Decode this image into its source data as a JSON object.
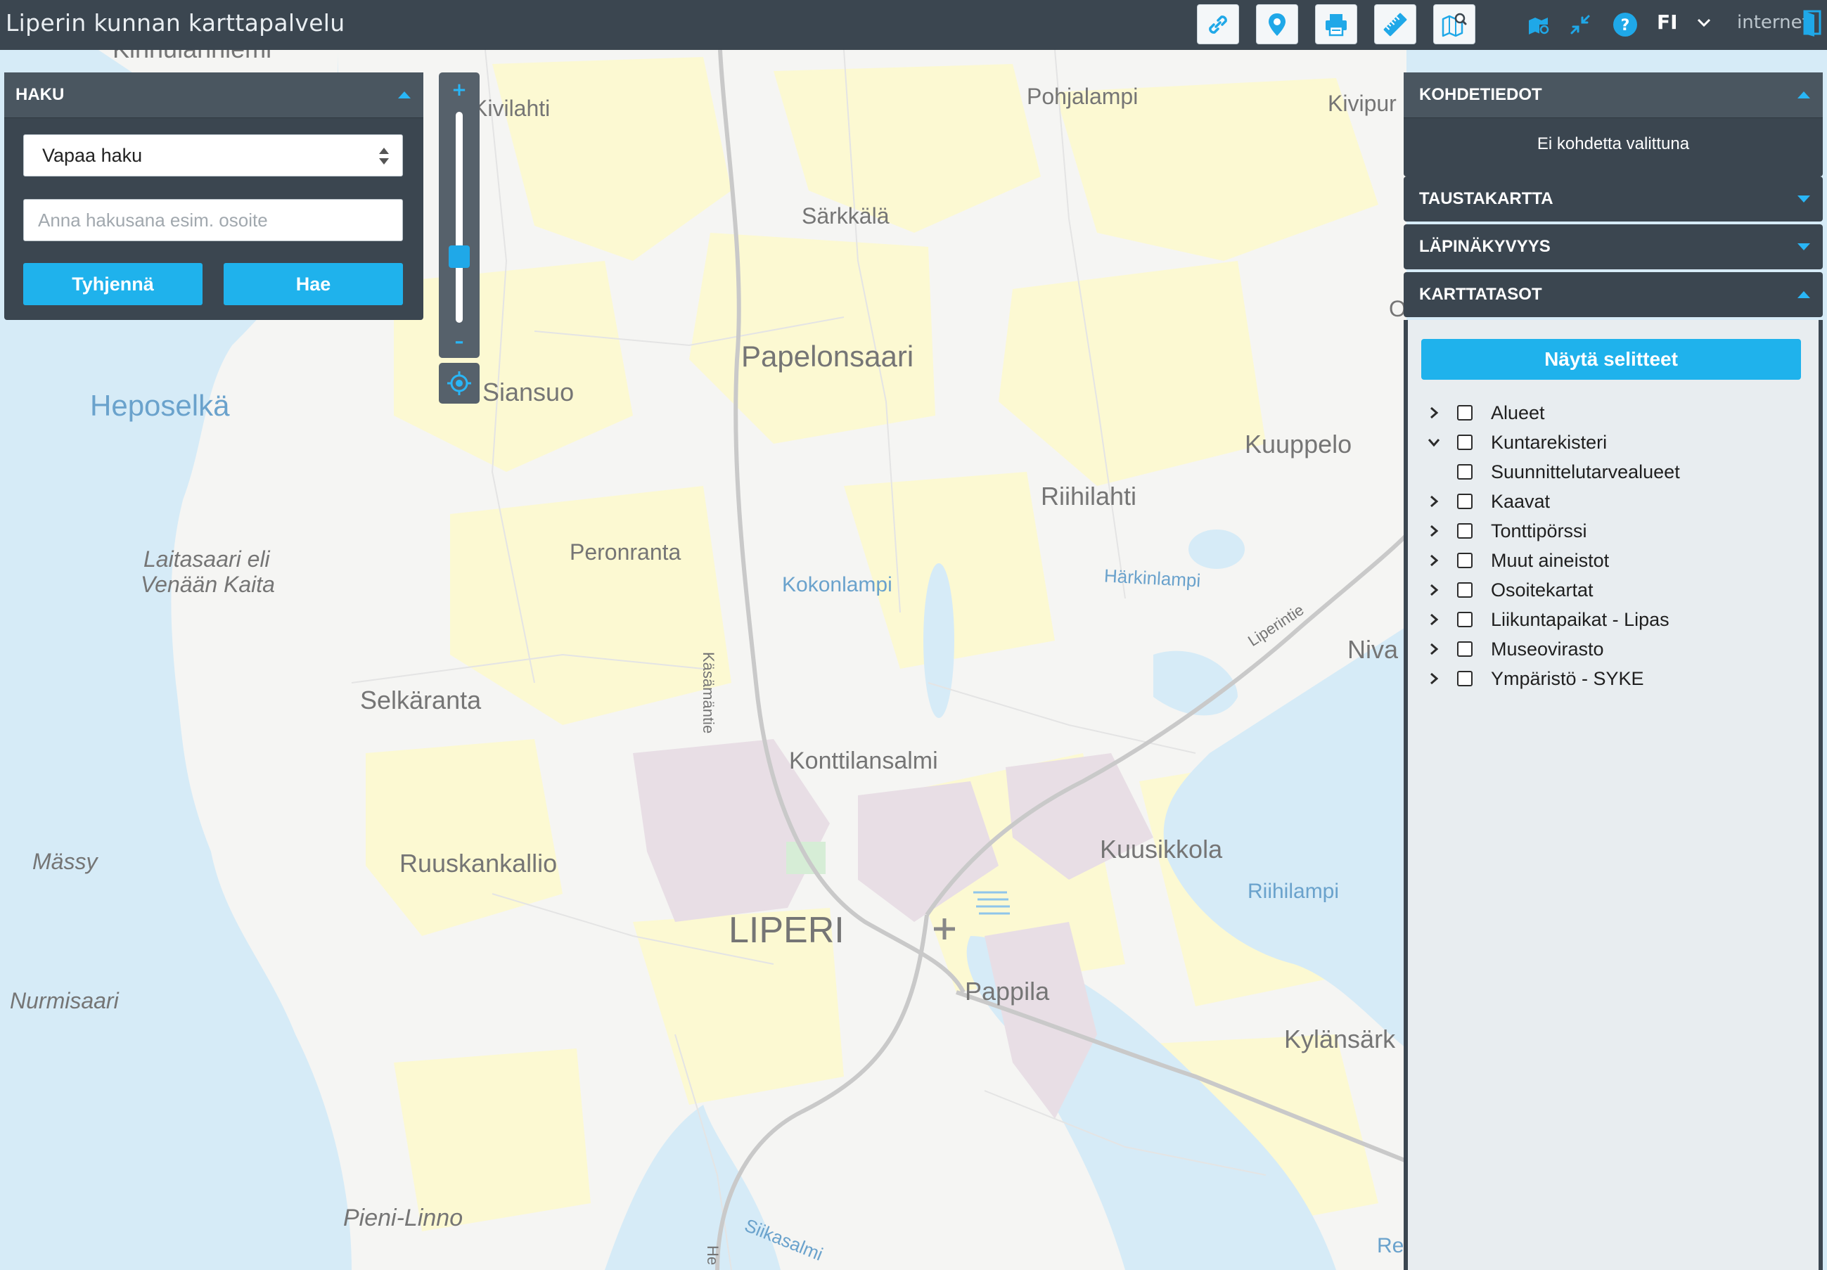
{
  "app": {
    "title": "Liperin kunnan karttapalvelu",
    "language": "FI",
    "user": "internet"
  },
  "colors": {
    "topbar": "#3b4650",
    "accent": "#1fb2ec",
    "land": "#f6f6f4",
    "forest": "#fdfbd8",
    "water": "#d6ebf7",
    "urban": "#e6dce4"
  },
  "toolbar": [
    {
      "icon": "link-icon"
    },
    {
      "icon": "location-pin-icon"
    },
    {
      "icon": "print-icon"
    },
    {
      "icon": "ruler-icon"
    },
    {
      "icon": "map-search-icon"
    }
  ],
  "search": {
    "header": "HAKU",
    "type_value": "Vapaa haku",
    "placeholder": "Anna hakusana esim. osoite",
    "clear_label": "Tyhjennä",
    "search_label": "Hae"
  },
  "zoom": {
    "in_label": "+",
    "out_label": "–",
    "level": 0.29
  },
  "info": {
    "header": "KOHDETIEDOT",
    "empty_text": "Ei kohdetta valittuna"
  },
  "panels": {
    "background_map": "TAUSTAKARTTA",
    "transparency": "LÄPINÄKYVYYS",
    "layers": "KARTTATASOT"
  },
  "layers": {
    "legend_button": "Näytä selitteet",
    "items": [
      {
        "label": "Alueet",
        "expanded": false,
        "level": 0
      },
      {
        "label": "Kuntarekisteri",
        "expanded": true,
        "level": 0
      },
      {
        "label": "Suunnittelutarvealueet",
        "expanded": false,
        "level": 1
      },
      {
        "label": "Kaavat",
        "expanded": false,
        "level": 0
      },
      {
        "label": "Tonttipörssi",
        "expanded": false,
        "level": 0
      },
      {
        "label": "Muut aineistot",
        "expanded": false,
        "level": 0
      },
      {
        "label": "Osoitekartat",
        "expanded": false,
        "level": 0
      },
      {
        "label": "Liikuntapaikat - Lipas",
        "expanded": false,
        "level": 0
      },
      {
        "label": "Museovirasto",
        "expanded": false,
        "level": 0
      },
      {
        "label": "Ympäristö - SYKE",
        "expanded": false,
        "level": 0
      }
    ]
  },
  "map_labels": {
    "kinnulanniemi": "Kinnulanniemi",
    "kivilahti": "Kivilahti",
    "pohjalampi": "Pohjalampi",
    "kivipuro": "Kivipur",
    "sarkkala": "Särkkälä",
    "papelonsaari": "Papelonsaari",
    "siansuo": "Siansuo",
    "heposelka": "Heposelkä",
    "kuuppelo": "Kuuppelo",
    "riihilahti": "Riihilahti",
    "o": "O",
    "peronranta": "Peronranta",
    "laitasaari_1": "Laitasaari eli",
    "laitasaari_2": "Venään Kaita",
    "kokonlampi": "Kokonlampi",
    "harkinlampi": "Härkinlampi",
    "kasamantie": "Käsämäntie",
    "liperintie": "Liperintie",
    "niva": "Niva",
    "selkaranta": "Selkäranta",
    "konttilansalmi": "Konttilansalmi",
    "kuusikkola": "Kuusikkola",
    "massy": "Mässy",
    "ruuskankallio": "Ruuskankallio",
    "riihilampi": "Riihilampi",
    "liperi": "LIPERI",
    "pappila": "Pappila",
    "nurmisaari": "Nurmisaari",
    "kylansarki": "Kylänsärk",
    "pieni_linno": "Pieni-Linno",
    "siikasalmi": "Siikasalmi",
    "he": "He",
    "re": "Re"
  }
}
